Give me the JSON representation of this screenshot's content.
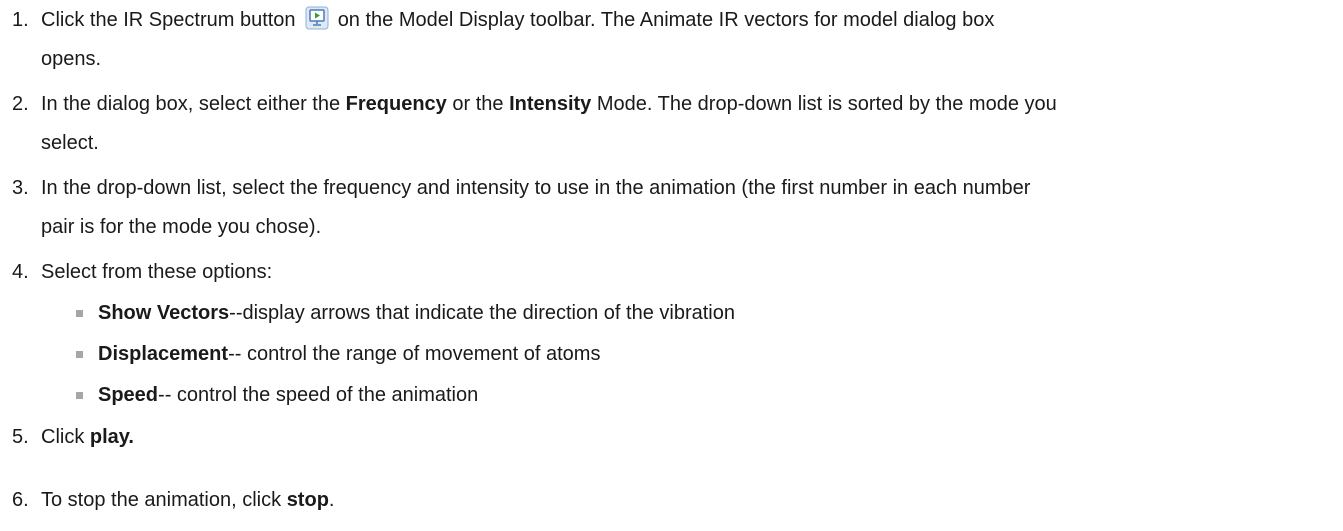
{
  "steps": [
    {
      "number": "1.",
      "text_a": "Click the IR Spectrum button",
      "icon": "ir-spectrum-button-icon",
      "text_b": "on the Model Display toolbar. The Animate IR vectors for model dialog box",
      "line2": "opens."
    },
    {
      "number": "2.",
      "text_a": "In the dialog box, select either the ",
      "bold_a": "Frequency",
      "text_b": " or the ",
      "bold_b": "Intensity",
      "text_c": " Mode. The drop-down list is sorted by the mode you",
      "line2": "select."
    },
    {
      "number": "3.",
      "line1": "In the drop-down list, select the frequency and intensity to use in the animation (the first number in each number",
      "line2": "pair is for the mode you chose)."
    },
    {
      "number": "4.",
      "line1": "Select from these options:"
    },
    {
      "number": "5.",
      "text_a": "Click ",
      "bold_a": "play."
    },
    {
      "number": "6.",
      "text_a": "To stop the animation, click ",
      "bold_a": "stop",
      "text_b": "."
    }
  ],
  "options": [
    {
      "bold": "Show Vectors",
      "text": "--display arrows that indicate the direction of the vibration"
    },
    {
      "bold": "Displacement",
      "text": "-- control the range of movement of atoms"
    },
    {
      "bold": "Speed",
      "text": "-- control the speed of the animation"
    }
  ],
  "colors": {
    "text": "#1a1a1a",
    "bullet": "#a6a6a6",
    "icon_accent": "#3a9b3a",
    "icon_frame": "#4a7ab8"
  }
}
